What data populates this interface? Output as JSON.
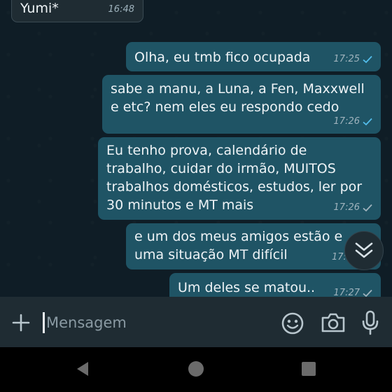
{
  "header_bubble": {
    "sender": "Yumi*",
    "time": "16:48"
  },
  "messages": [
    {
      "text": "Olha, eu tmb fico ocupada",
      "time": "17:25",
      "status": "read"
    },
    {
      "text": "sabe a manu, a Luna, a Fen, Maxxwell\ne etc? nem eles eu respondo cedo",
      "time": "17:26",
      "status": "read"
    },
    {
      "text": "Eu tenho prova, calendário de\ntrabalho, cuidar do irmão, MUITOS\ntrabalhos domésticos, estudos, ler por\n30 minutos e MT mais",
      "time": "17:26",
      "status": "sent"
    },
    {
      "text": "e um dos meus amigos estão e\numa situação MT difícil",
      "time": "17:2",
      "status": "sent"
    },
    {
      "text": "Um deles se matou..",
      "time": "17:27",
      "status": "sent"
    }
  ],
  "composer": {
    "placeholder": "Mensagem"
  },
  "icons": {
    "attach": "plus-icon",
    "emoji": "emoji-icon",
    "camera": "camera-icon",
    "mic": "microphone-icon",
    "scroll": "double-chevron-down-icon",
    "nav_back": "back-triangle-icon",
    "nav_home": "home-circle-icon",
    "nav_recent": "recent-square-icon"
  },
  "colors": {
    "background": "#0f1d26",
    "outgoing_bubble": "#1f5465",
    "incoming_bubble": "#1f2c33",
    "read_tick": "#53bdeb",
    "sent_tick": "#9fb3bd"
  }
}
